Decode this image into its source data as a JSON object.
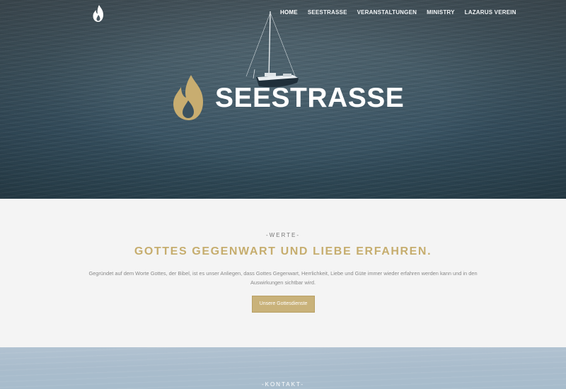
{
  "nav": {
    "items": [
      {
        "label": "HOME",
        "active": true
      },
      {
        "label": "SEESTRASSE",
        "active": false
      },
      {
        "label": "VERANSTALTUNGEN",
        "active": false
      },
      {
        "label": "MINISTRY",
        "active": false
      },
      {
        "label": "LAZARUS VEREIN",
        "active": false
      }
    ]
  },
  "hero": {
    "brand_title": "SEESTRASSE",
    "logo_icon": "flame-icon",
    "flame_color": "#c8ad70"
  },
  "werte": {
    "eyebrow": "-WERTE-",
    "headline": "GOTTES GEGENWART UND LIEBE ERFAHREN.",
    "body": "Gegründet auf dem Worte Gottes, der Bibel, ist es unser Anliegen, dass Gottes Gegenwart, Herrlichkeit, Liebe und Güte immer wieder erfahren werden kann und in den Auswirkungen sichtbar wird.",
    "button_label": "Unsere Gottesdienste",
    "accent_color": "#c6ad6e"
  },
  "kontakt": {
    "eyebrow": "-KONTAKT-"
  }
}
